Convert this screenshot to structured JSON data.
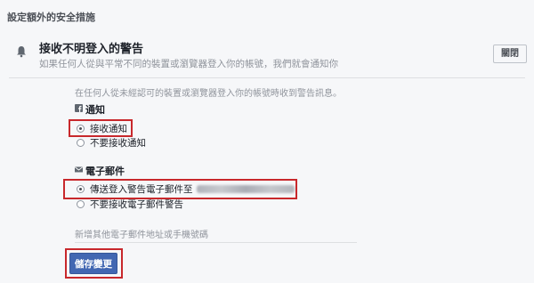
{
  "header": {
    "title": "設定額外的安全措施"
  },
  "section": {
    "title": "接收不明登入的警告",
    "description": "如果任何人從與平常不同的裝置或瀏覽器登入你的帳號，我們就會通知你",
    "close_label": "關閉",
    "icon": "bell-icon"
  },
  "panel": {
    "intro": "在任何人從未經認可的裝置或瀏覽器登入你的帳號時收到警告訊息。",
    "notifications": {
      "title": "通知",
      "icon": "facebook-icon",
      "options": [
        {
          "label": "接收通知",
          "checked": true
        },
        {
          "label": "不要接收通知",
          "checked": false
        }
      ]
    },
    "email": {
      "title": "電子郵件",
      "icon": "envelope-icon",
      "options": [
        {
          "label": "傳送登入警告電子郵件至",
          "checked": true
        },
        {
          "label": "不要接收電子郵件警告",
          "checked": false
        }
      ]
    },
    "add_contact": "新增其他電子郵件地址或手機號碼",
    "save_label": "儲存變更"
  },
  "colors": {
    "highlight": "#c8282c",
    "primary_button": "#4267b2",
    "background": "#f6f7f9"
  }
}
